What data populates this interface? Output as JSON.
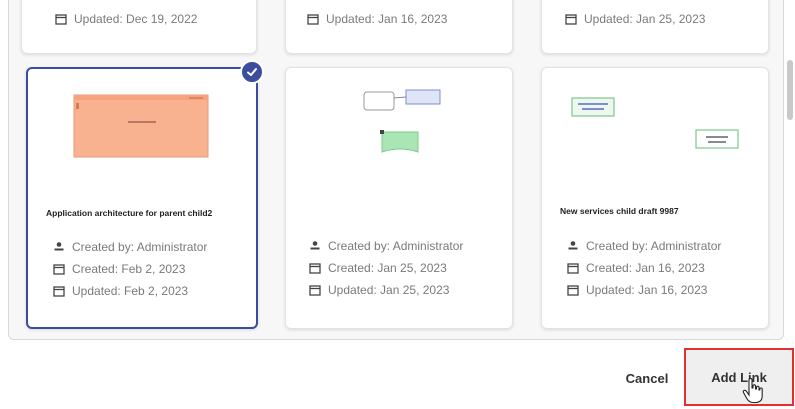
{
  "top_row": [
    {
      "updated": "Updated: Dec 19, 2022"
    },
    {
      "updated": "Updated: Jan 16, 2023"
    },
    {
      "updated": "Updated: Jan 25, 2023"
    }
  ],
  "cards": [
    {
      "title": "Application architecture for parent child2",
      "created_by": "Created by: Administrator",
      "created": "Created: Feb 2, 2023",
      "updated": "Updated: Feb 2, 2023",
      "selected": true
    },
    {
      "title": "",
      "created_by": "Created by: Administrator",
      "created": "Created: Jan 25, 2023",
      "updated": "Updated: Jan 25, 2023",
      "selected": false
    },
    {
      "title": "New services child draft 9987",
      "created_by": "Created by: Administrator",
      "created": "Created: Jan 16, 2023",
      "updated": "Updated: Jan 16, 2023",
      "selected": false
    }
  ],
  "footer": {
    "cancel_label": "Cancel",
    "add_link_label": "Add Link"
  },
  "colors": {
    "selection": "#3b4d9c",
    "highlight_box": "#e03030",
    "thumb_orange": "#f9b28f",
    "thumb_green": "#a9e6b3"
  },
  "icons": [
    "calendar-icon",
    "person-icon",
    "check-icon",
    "hand-cursor-icon"
  ]
}
